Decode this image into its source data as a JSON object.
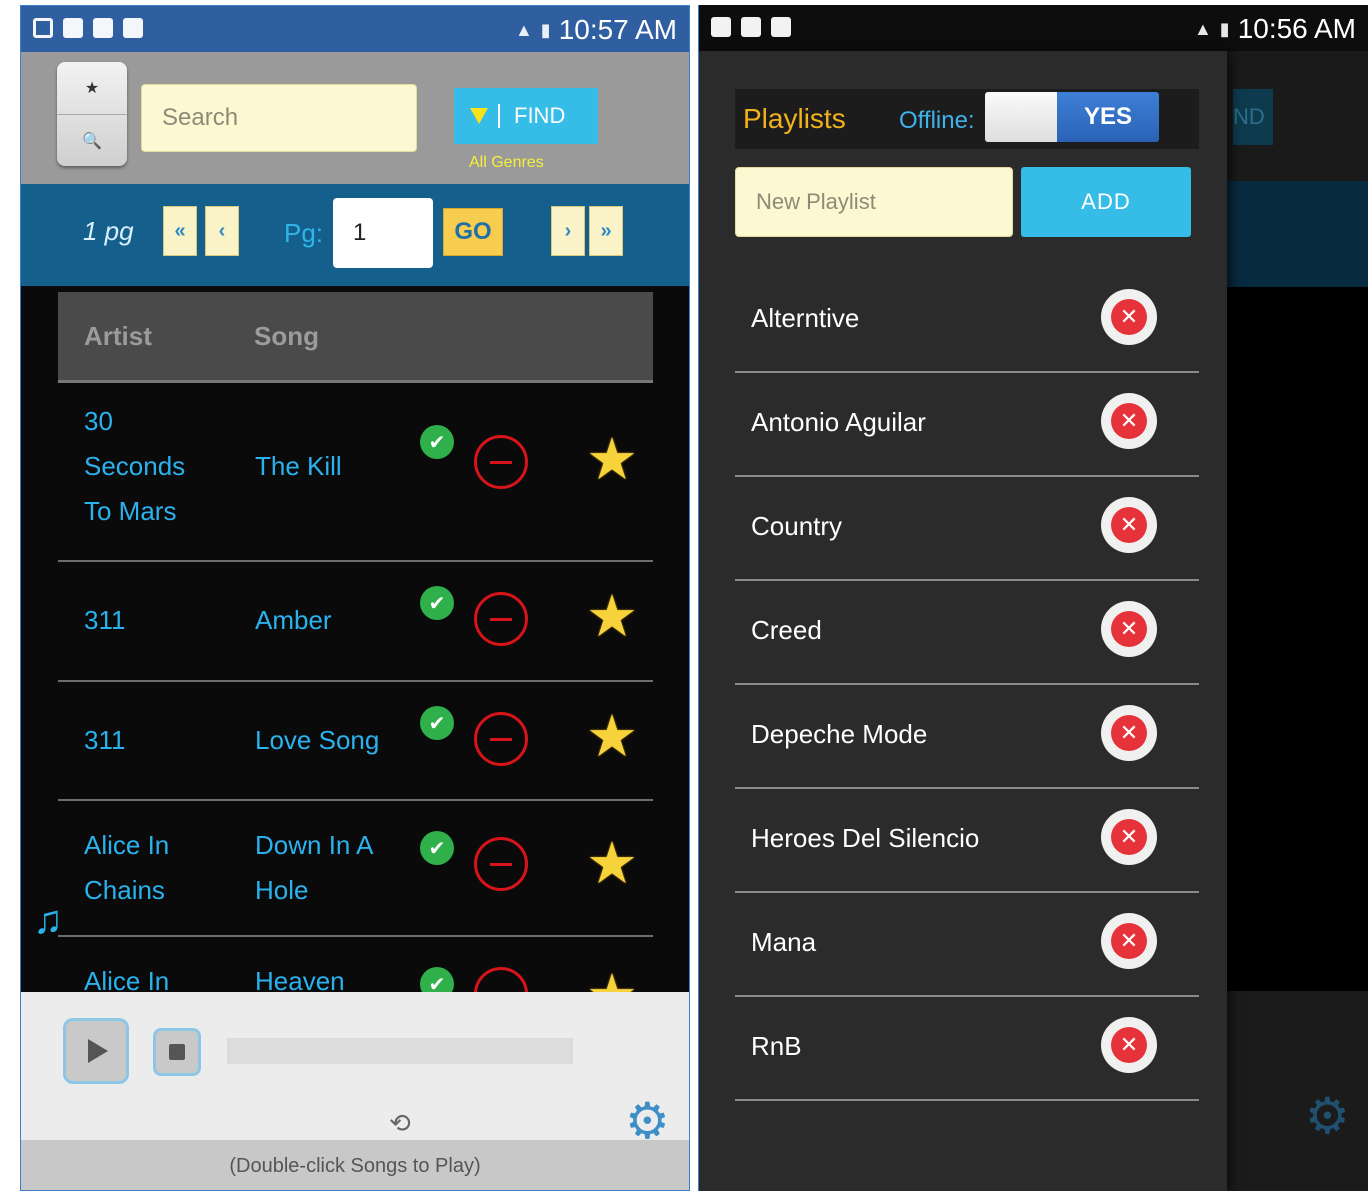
{
  "left": {
    "status_time": "10:57 AM",
    "search": {
      "placeholder": "Search",
      "star_icon": "★",
      "mag_icon": "🔍"
    },
    "find": {
      "label": "FIND"
    },
    "genre_filter": "All Genres",
    "pager": {
      "pages": "1 pg",
      "first": "«",
      "prev": "‹",
      "next": "›",
      "last": "»",
      "pg_label": "Pg:",
      "page_value": "1",
      "go": "GO"
    },
    "table": {
      "headers": {
        "artist": "Artist",
        "song": "Song"
      },
      "rows": [
        {
          "artist": "30 Seconds To Mars",
          "song": "The Kill"
        },
        {
          "artist": "311",
          "song": "Amber"
        },
        {
          "artist": "311",
          "song": "Love Song"
        },
        {
          "artist": "Alice In Chains",
          "song": "Down In A Hole"
        },
        {
          "artist": "Alice In",
          "song": "Heaven"
        }
      ]
    },
    "player": {
      "progress": 0,
      "repeat_icon": "⟲",
      "hint": "(Double-click Songs to Play)"
    },
    "icons": {
      "check": "✔",
      "star": "★",
      "gear": "⚙",
      "playlist": "♫"
    }
  },
  "right": {
    "status_time": "10:56 AM",
    "backdrop_find": "ND",
    "drawer": {
      "title": "Playlists",
      "offline_label": "Offline:",
      "offline_value": "YES",
      "new_placeholder": "New Playlist",
      "add": "ADD",
      "playlists": [
        "Alterntive",
        "Antonio Aguilar",
        "Country",
        "Creed",
        "Depeche Mode",
        "Heroes Del Silencio",
        "Mana",
        "RnB"
      ]
    }
  },
  "colors": {
    "accent_blue": "#35bde8",
    "link_blue": "#2ab2ee",
    "header_blue": "#145f8c",
    "star_gold": "#f6d33a",
    "delete_red": "#e5323b",
    "playlist_title": "#f2b21a"
  }
}
